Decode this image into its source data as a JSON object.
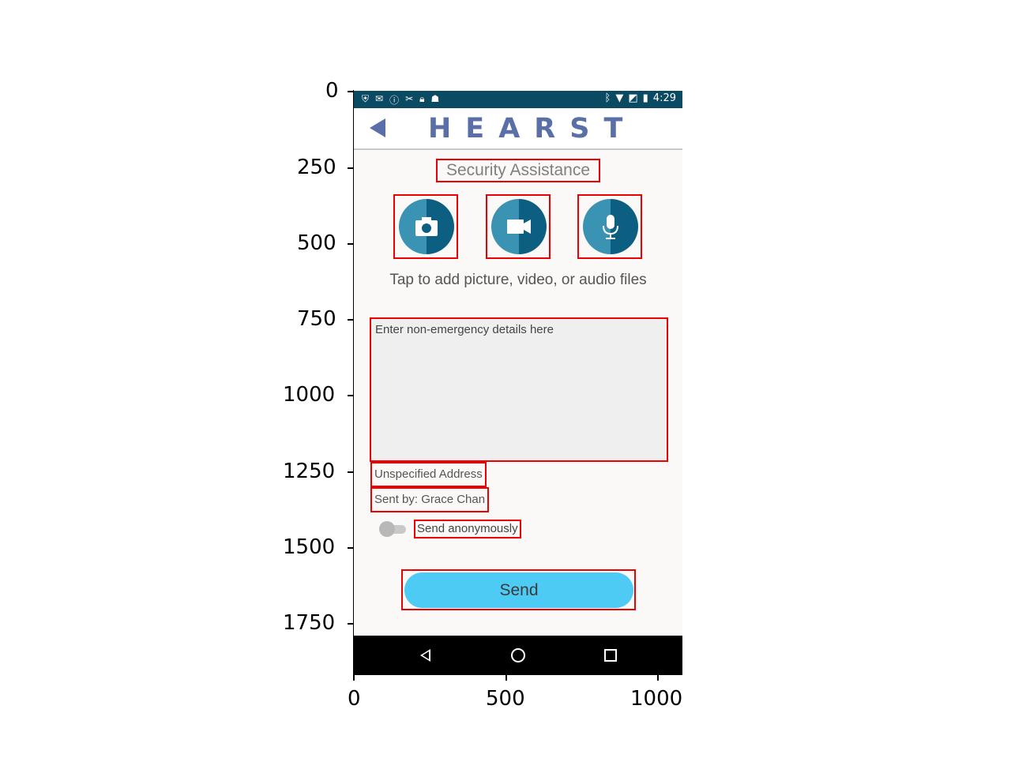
{
  "axes": {
    "y_ticks": [
      "0",
      "250",
      "500",
      "750",
      "1000",
      "1250",
      "1500",
      "1750"
    ],
    "x_ticks": [
      "0",
      "500",
      "1000"
    ]
  },
  "status_bar": {
    "time": "4:29",
    "left_icons": [
      "shield-icon",
      "message-icon",
      "info-icon",
      "tools-icon",
      "lock-icon",
      "android-icon"
    ],
    "right_icons": [
      "bluetooth-icon",
      "wifi-icon",
      "no-sim-icon",
      "battery-charging-icon"
    ]
  },
  "header": {
    "brand": "HEARST",
    "brand_color": "#5a6fa8"
  },
  "main": {
    "title": "Security Assistance",
    "media_buttons": [
      {
        "icon": "camera-icon"
      },
      {
        "icon": "video-camera-icon"
      },
      {
        "icon": "microphone-icon"
      }
    ],
    "hint": "Tap to add picture, video, or audio files",
    "details_placeholder": "Enter non-emergency details here",
    "address": "Unspecified Address",
    "sender": "Sent by: Grace Chan",
    "anonymous_label": "Send anonymously",
    "anonymous_enabled": false,
    "send_label": "Send",
    "send_color": "#4ecbf5"
  },
  "colors": {
    "status_bar": "#0a4a63",
    "highlight_box": "#ee0000"
  }
}
